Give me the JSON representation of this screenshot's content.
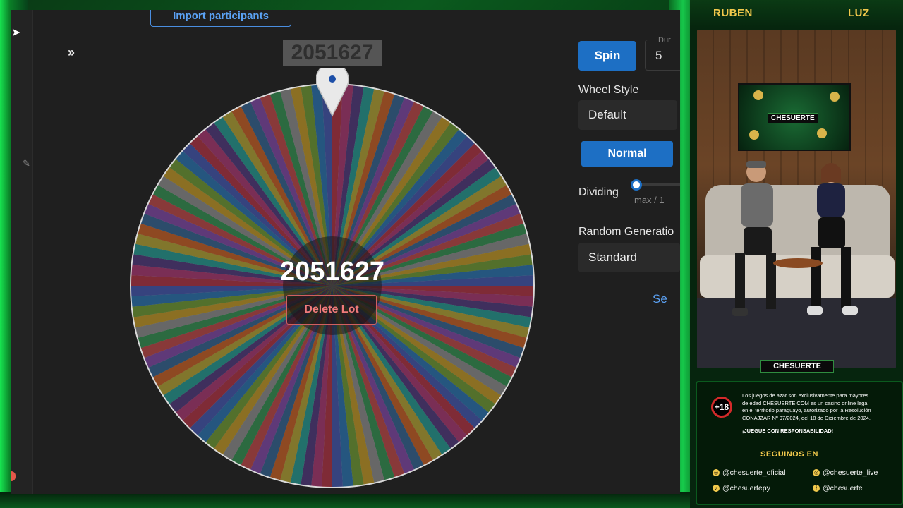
{
  "app": {
    "import_button": "Import participants",
    "expand_icon": "double-chevron-right-icon",
    "winner_top": "2051627",
    "winner_center": "2051627",
    "delete_button": "Delete Lot",
    "spin_button": "Spin",
    "duration_label": "Dur",
    "duration_value": "5",
    "wheel_style_label": "Wheel Style",
    "wheel_style_value": "Default",
    "mode_button": "Normal",
    "dividing_label": "Dividing",
    "dividing_sub": "max / 1",
    "dividing_value": 0,
    "random_label": "Random Generatio",
    "random_value": "Standard",
    "link_text": "Se"
  },
  "stream": {
    "host_left": "RUBEN",
    "host_right": "LUZ",
    "logo": "CHESUERTE",
    "age_badge": "+18",
    "disclaimer_1": "Los juegos de azar son exclusivamente para mayores",
    "disclaimer_2": "de edad CHESUERTE.COM es un casino online legal",
    "disclaimer_3": "en el territorio paraguayo, autorizado por la Resolución",
    "disclaimer_4": "CONAJZAR Nº 97/2024, del 18 de Diciembre de 2024.",
    "responsibility": "¡JUEGUE CON RESPONSABILIDAD!",
    "follow_title": "SEGUINOS EN",
    "social": [
      {
        "icon": "instagram-icon",
        "handle": "@chesuerte_oficial"
      },
      {
        "icon": "instagram-icon",
        "handle": "@chesuerte_live"
      },
      {
        "icon": "tiktok-icon",
        "handle": "@chesuertepy"
      },
      {
        "icon": "facebook-icon",
        "handle": "@chesuerte"
      }
    ]
  },
  "colors": {
    "accent": "#1d6fc4",
    "danger": "#f07b7b",
    "brand_green": "#0b5a1e",
    "gold": "#f2c94c"
  }
}
